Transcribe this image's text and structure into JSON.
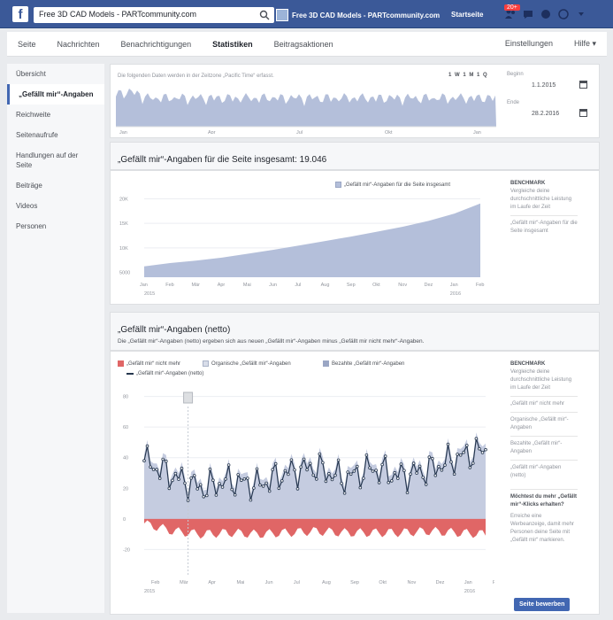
{
  "topbar": {
    "search_value": "Free 3D CAD Models - PARTcommunity.com",
    "profile_name": "Free 3D CAD Models - PARTcommunity.com",
    "home_label": "Startseite",
    "notif_count": "20+"
  },
  "pagenav": {
    "items": [
      "Seite",
      "Nachrichten",
      "Benachrichtigungen",
      "Statistiken",
      "Beitragsaktionen"
    ],
    "active": "Statistiken",
    "right": [
      "Einstellungen",
      "Hilfe ▾"
    ]
  },
  "sidebar": {
    "items": [
      "Übersicht",
      "„Gefällt mir“-Angaben",
      "Reichweite",
      "Seitenaufrufe",
      "Handlungen auf der Seite",
      "Beiträge",
      "Videos",
      "Personen"
    ]
  },
  "range": {
    "hint": "Die folgenden Daten werden in der Zeitzone „Pacific Time“ erfasst.",
    "buttons": "1 W  1 M  1 Q",
    "begin_label": "Beginn",
    "begin_value": "1.1.2015",
    "end_label": "Ende",
    "end_value": "28.2.2016",
    "x_ticks": [
      "Jan",
      "Apr",
      "Jul",
      "Okt",
      "Jan"
    ]
  },
  "total_likes": {
    "title": "„Gefällt mir“-Angaben für die Seite insgesamt: 19.046",
    "legend": "„Gefällt mir“-Angaben für die Seite insgesamt",
    "benchmark_hdr": "BENCHMARK",
    "benchmark_text": "Vergleiche deine durchschnittliche Leistung im Laufe der Zeit",
    "benchmark_item": "„Gefällt mir“-Angaben für die Seite insgesamt",
    "y_ticks": [
      "20K",
      "15K",
      "10K",
      "5000"
    ],
    "x_ticks": [
      "Jan",
      "Feb",
      "Mär",
      "Apr",
      "Mai",
      "Jun",
      "Jul",
      "Aug",
      "Sep",
      "Okt",
      "Nov",
      "Dez",
      "Jan",
      "Feb"
    ],
    "year_ticks": [
      "2015",
      "2016"
    ]
  },
  "net_likes": {
    "title": "„Gefällt mir“-Angaben (netto)",
    "subtitle": "Die „Gefällt mir“-Angaben (netto) ergeben sich aus neuen „Gefällt mir“-Angaben minus „Gefällt mir nicht mehr“-Angaben.",
    "legend": [
      "„Gefällt mir“ nicht mehr",
      "Organische „Gefällt mir“-Angaben",
      "Bezahlte „Gefällt mir“-Angaben",
      "„Gefällt mir“-Angaben (netto)"
    ],
    "benchmark_hdr": "BENCHMARK",
    "benchmark_text": "Vergleiche deine durchschnittliche Leistung im Laufe der Zeit",
    "benchmark_items": [
      "„Gefällt mir“ nicht mehr",
      "Organische „Gefällt mir“-Angaben",
      "Bezahlte „Gefällt mir“-Angaben",
      "„Gefällt mir“-Angaben (netto)"
    ],
    "promo_title": "Möchtest du mehr „Gefällt mir“-Klicks erhalten?",
    "promo_text": "Erreiche eine Werbeanzeige, damit mehr Personen deine Seite mit „Gefällt mir“ markieren.",
    "promo_button": "Seite bewerben",
    "y_ticks": [
      "80",
      "60",
      "40",
      "20",
      "0",
      "-20"
    ],
    "x_ticks": [
      "Feb",
      "Mär",
      "Apr",
      "Mai",
      "Jun",
      "Jul",
      "Aug",
      "Sep",
      "Okt",
      "Nov",
      "Dez",
      "Jan",
      "Feb"
    ],
    "year_ticks": [
      "2015",
      "2016"
    ]
  },
  "colors": {
    "brand": "#3b5998",
    "area": "#b4bfda",
    "unlike": "#e06666",
    "net_line": "#26374f"
  },
  "chart_data": [
    {
      "type": "area",
      "title": "„Gefällt mir“-Angaben für die Seite insgesamt: 19.046",
      "x": [
        "Jan",
        "Feb",
        "Mär",
        "Apr",
        "Mai",
        "Jun",
        "Jul",
        "Aug",
        "Sep",
        "Okt",
        "Nov",
        "Dez",
        "Jan",
        "Feb"
      ],
      "series": [
        {
          "name": "„Gefällt mir“-Angaben für die Seite insgesamt",
          "values": [
            6200,
            6900,
            7400,
            8000,
            8800,
            9600,
            10500,
            11400,
            12300,
            13300,
            14300,
            15500,
            17000,
            19046
          ]
        }
      ],
      "ylim": [
        4000,
        21000
      ]
    },
    {
      "type": "line",
      "title": "„Gefällt mir“-Angaben (netto)",
      "x": [
        "Feb",
        "Mär",
        "Apr",
        "Mai",
        "Jun",
        "Jul",
        "Aug",
        "Sep",
        "Okt",
        "Nov",
        "Dez",
        "Jan",
        "Feb"
      ],
      "series": [
        {
          "name": "„Gefällt mir“-Angaben (netto)",
          "values": [
            38,
            28,
            20,
            25,
            22,
            30,
            34,
            26,
            33,
            28,
            32,
            40,
            45
          ]
        },
        {
          "name": "„Gefällt mir“ nicht mehr",
          "values": [
            -3,
            -8,
            -10,
            -9,
            -10,
            -9,
            -8,
            -9,
            -9,
            -9,
            -8,
            -9,
            -10
          ]
        }
      ],
      "ylim": [
        -25,
        85
      ]
    }
  ]
}
